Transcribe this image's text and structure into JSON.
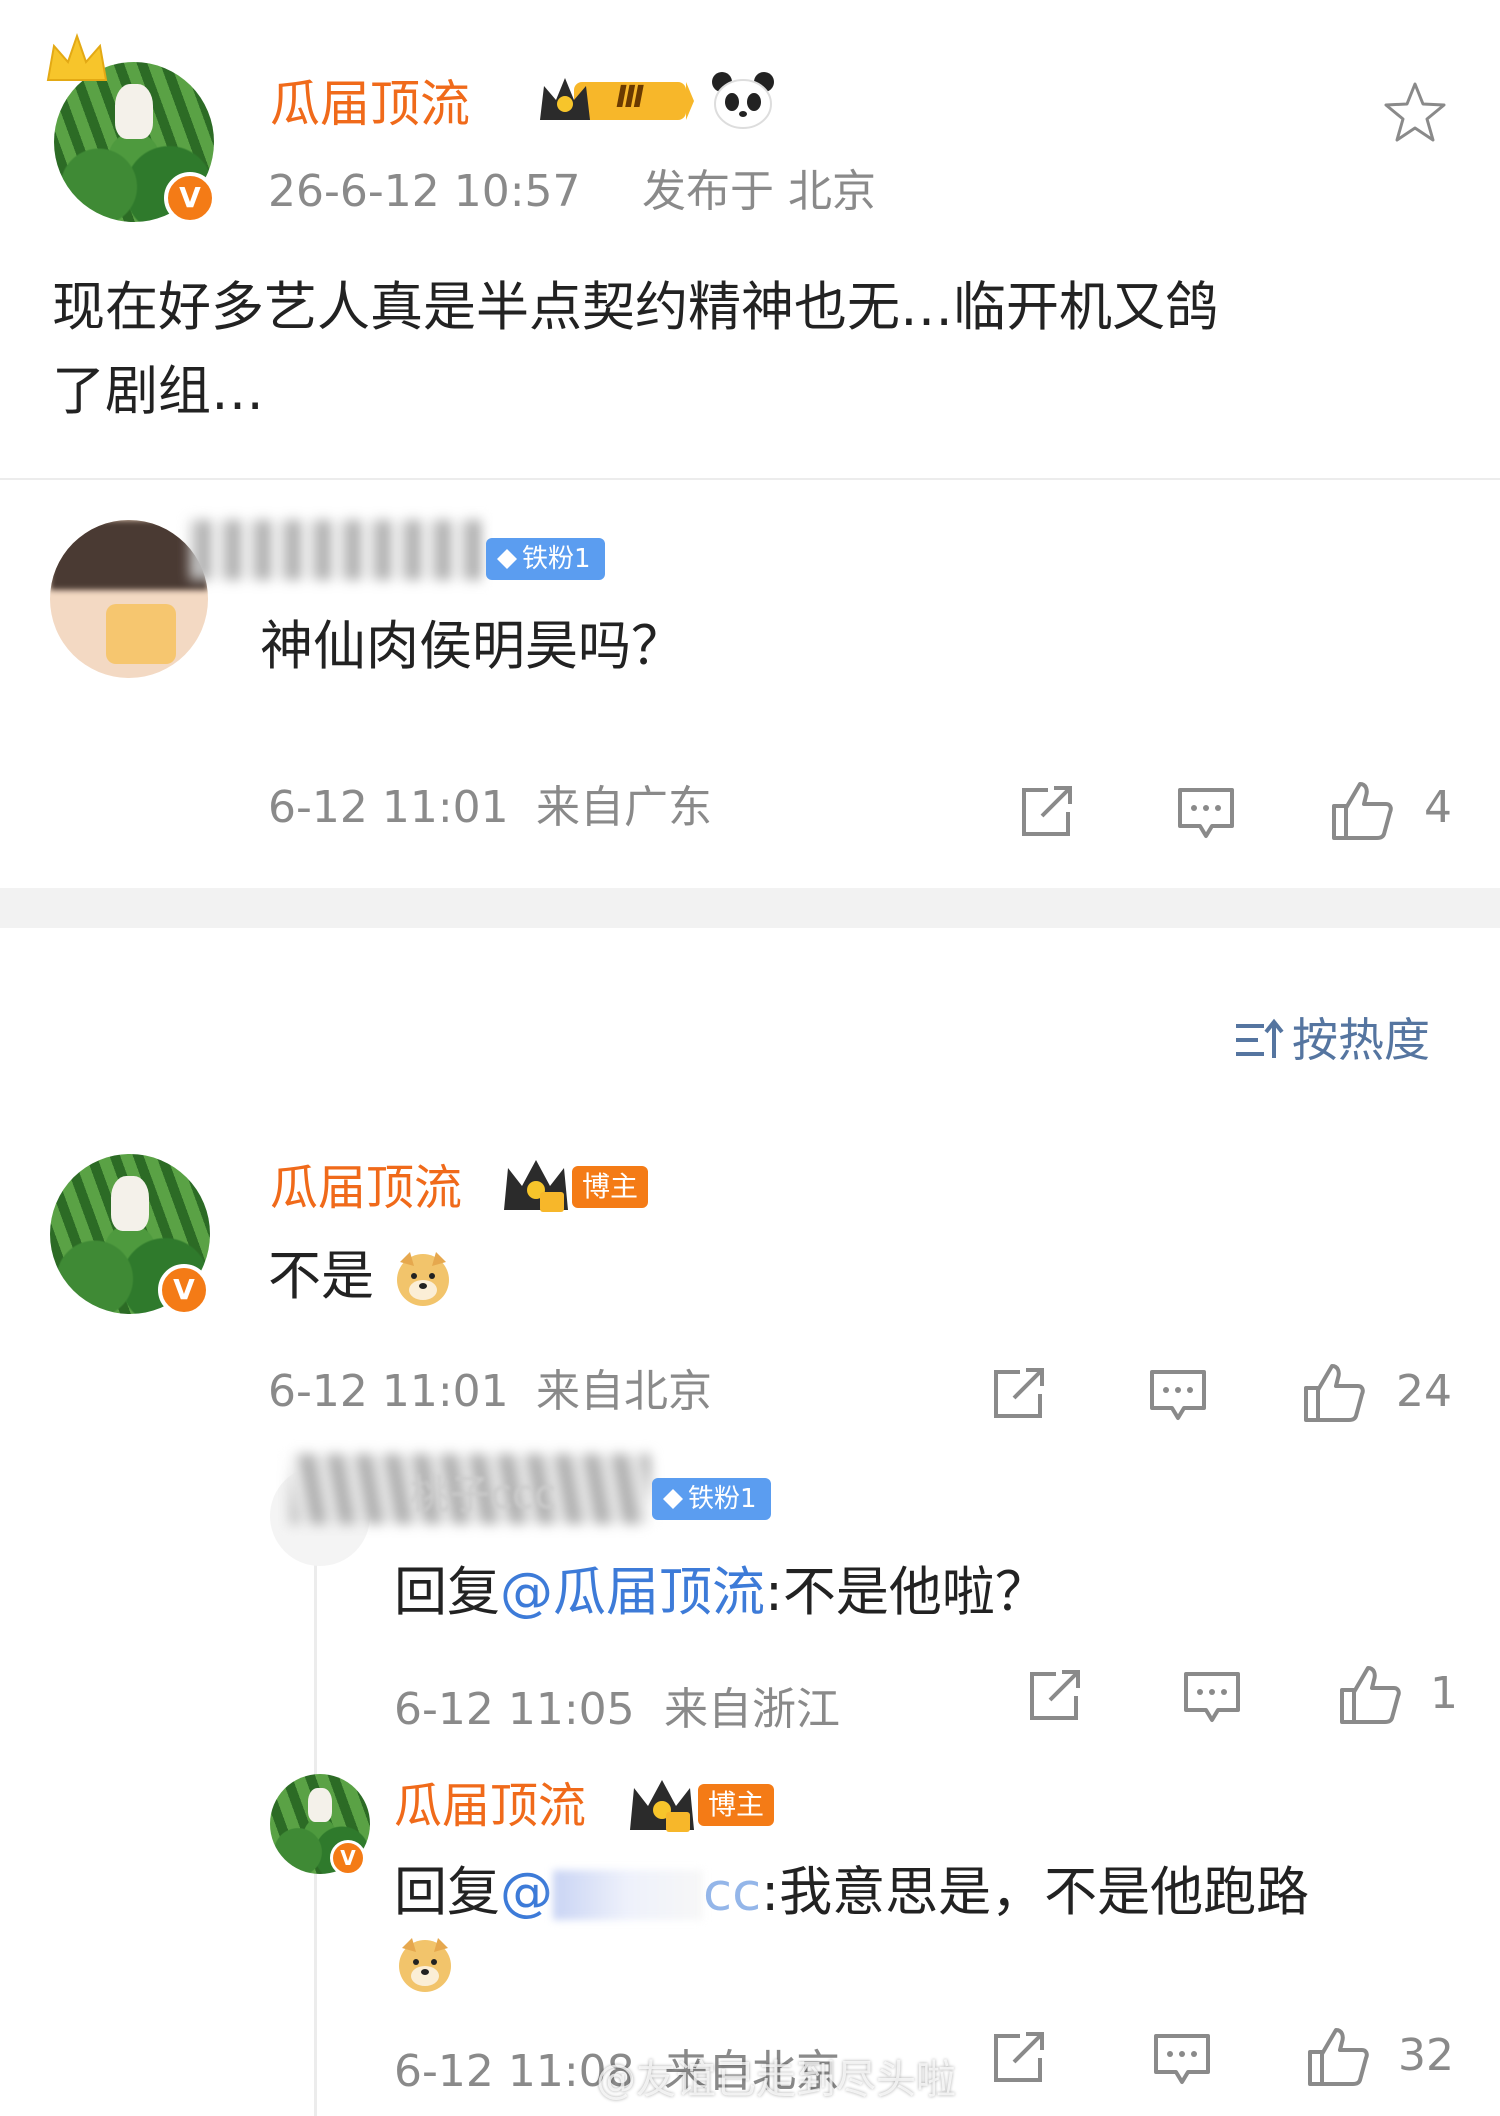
{
  "post": {
    "author": "瓜届顶流",
    "level_badge": "Ⅲ",
    "time": "26-6-12 10:57",
    "location": "发布于 北京",
    "text_line1": "现在好多艺人真是半点契约精神也无…临开机又鸽",
    "text_line2": "了剧组…"
  },
  "comment1": {
    "badge": "铁粉1",
    "text": "神仙肉侯明昊吗？",
    "time": "6-12 11:01",
    "location": "来自广东",
    "likes": "4"
  },
  "sort_label": "按热度",
  "reply1": {
    "author": "瓜届顶流",
    "badge": "博主",
    "text": "不是",
    "time": "6-12 11:01",
    "location": "来自北京",
    "likes": "24"
  },
  "reply2": {
    "name_partial": "桃子ccc",
    "badge": "铁粉1",
    "prefix": "回复",
    "mention": "@瓜届顶流",
    "text": ":不是他啦？",
    "time": "6-12 11:05",
    "location": "来自浙江",
    "likes": "1"
  },
  "reply3": {
    "author": "瓜届顶流",
    "badge": "博主",
    "prefix": "回复",
    "mention_start": "@",
    "mention_end": "cc",
    "text": ":我意思是，不是他跑路",
    "time": "6-12 11:08",
    "location": "来自北京",
    "likes": "32"
  },
  "watermark": "@友谊已走到尽头啦",
  "colors": {
    "name": "#f06a1a",
    "mention": "#3d7bd8",
    "meta": "#8a8a8a",
    "fan_badge": "#5b9df0",
    "blogger_badge": "#f47b16"
  },
  "icons": [
    "star-icon",
    "share-icon",
    "comment-icon",
    "like-icon",
    "sort-icon",
    "panda-icon",
    "doge-emoji"
  ]
}
